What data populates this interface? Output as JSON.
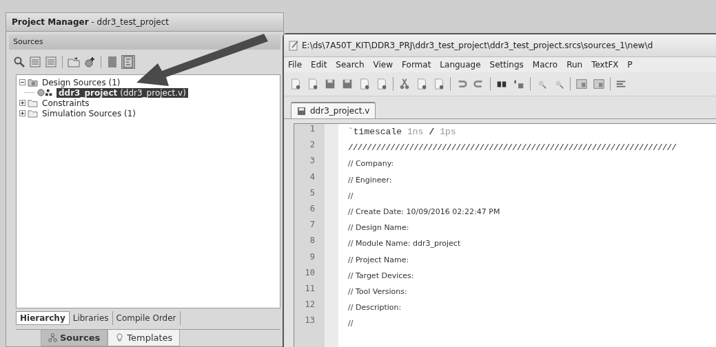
{
  "project_manager": {
    "title": "**Project Manager** - ddr3_test_project",
    "sources_panel": {
      "title": "Sources",
      "tree": [
        {
          "label": "Design Sources (1)",
          "kind": "folder-design",
          "expanded": true,
          "selected": false,
          "children": [
            {
              "label": "**ddr3_project** (ddr3_project.v)",
              "kind": "module",
              "selected": true
            }
          ]
        },
        {
          "label": "Constraints",
          "kind": "folder",
          "expanded": false,
          "selected": false
        },
        {
          "label": "Simulation Sources (1)",
          "kind": "folder",
          "expanded": false,
          "selected": false
        }
      ],
      "view_tabs": [
        {
          "label": "Hierarchy",
          "selected": true
        },
        {
          "label": "Libraries",
          "selected": false
        },
        {
          "label": "Compile Order",
          "selected": false
        }
      ]
    },
    "bottom_tabs": [
      {
        "label": "Sources",
        "kind": "sources",
        "selected": true
      },
      {
        "label": "Templates",
        "kind": "templates",
        "selected": false
      }
    ]
  },
  "editor": {
    "title": "E:\\ds\\7A50T_KIT\\DDR3_PRJ\\ddr3_test_project\\ddr3_test_project.srcs\\sources_1\\new\\d",
    "menu": [
      "File",
      "Edit",
      "Search",
      "View",
      "Format",
      "Language",
      "Settings",
      "Macro",
      "Run",
      "TextFX",
      "P"
    ],
    "tabs": [
      {
        "label": "ddr3_project.v",
        "selected": true
      }
    ],
    "lines": [
      {
        "number": "1",
        "tokens": [
          {
            "text": "`timescale",
            "kind": "directive"
          },
          {
            "text": "1ns",
            "kind": "number"
          },
          {
            "text": "/",
            "kind": "operator"
          },
          {
            "text": "1ps",
            "kind": "number"
          }
        ]
      },
      {
        "number": "2",
        "tokens": [
          {
            "text": "//////////////////////////////////////////////////////////////////////",
            "kind": "rule"
          }
        ]
      },
      {
        "number": "3",
        "tokens": [
          {
            "text": "// Company:",
            "kind": "comment"
          }
        ]
      },
      {
        "number": "4",
        "tokens": [
          {
            "text": "// Engineer:",
            "kind": "comment"
          }
        ]
      },
      {
        "number": "5",
        "tokens": [
          {
            "text": "//",
            "kind": "comment"
          }
        ]
      },
      {
        "number": "6",
        "tokens": [
          {
            "text": "// Create Date: 10/09/2016 02:22:47 PM",
            "kind": "comment"
          }
        ]
      },
      {
        "number": "7",
        "tokens": [
          {
            "text": "// Design Name:",
            "kind": "comment"
          }
        ]
      },
      {
        "number": "8",
        "tokens": [
          {
            "text": "// Module Name: ddr3_project",
            "kind": "comment"
          }
        ]
      },
      {
        "number": "9",
        "tokens": [
          {
            "text": "// Project Name:",
            "kind": "comment"
          }
        ]
      },
      {
        "number": "10",
        "tokens": [
          {
            "text": "// Target Devices:",
            "kind": "comment"
          }
        ]
      },
      {
        "number": "11",
        "tokens": [
          {
            "text": "// Tool Versions:",
            "kind": "comment"
          }
        ]
      },
      {
        "number": "12",
        "tokens": [
          {
            "text": "// Description:",
            "kind": "comment"
          }
        ]
      },
      {
        "number": "13",
        "tokens": [
          {
            "text": "//",
            "kind": "comment"
          }
        ]
      }
    ]
  }
}
